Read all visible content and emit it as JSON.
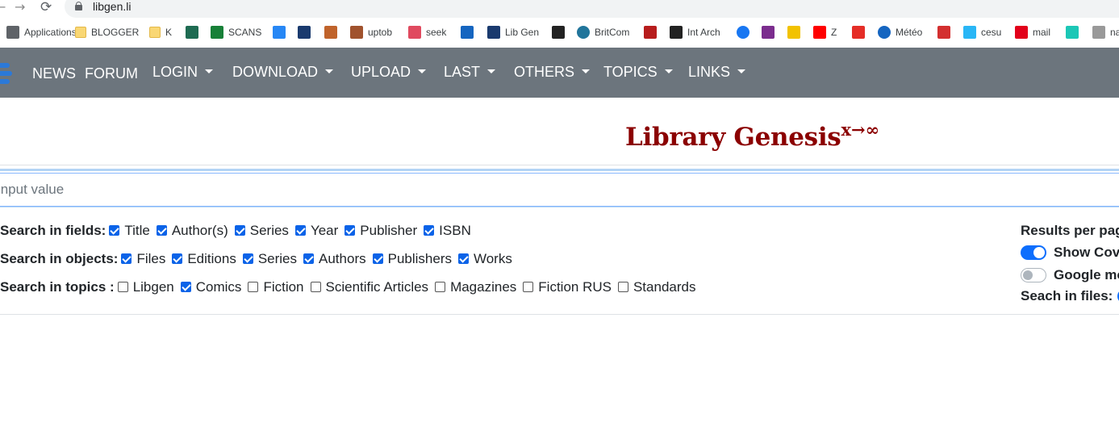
{
  "browser": {
    "back": "←",
    "forward": "→",
    "reload": "⟳",
    "url": "libgen.li",
    "bookmarks": [
      {
        "label": "Applications",
        "icon": "apps-grid-icon",
        "color": "#5f6368"
      },
      {
        "label": "BLOGGER",
        "icon": "folder-icon",
        "color": "#f9d774"
      },
      {
        "label": "K",
        "icon": "folder-icon",
        "color": "#f9d774"
      },
      {
        "label": "",
        "icon": "bookmark-icon",
        "color": "#1e6b52"
      },
      {
        "label": "SCANS",
        "icon": "plus-icon",
        "color": "#188038"
      },
      {
        "label": "",
        "icon": "vk-icon",
        "color": "#2787f5"
      },
      {
        "label": "",
        "icon": "site-icon",
        "color": "#1a3a6e"
      },
      {
        "label": "",
        "icon": "site-icon",
        "color": "#c0632b"
      },
      {
        "label": "uptob",
        "icon": "site-icon",
        "color": "#a0522d"
      },
      {
        "label": "seek",
        "icon": "site-icon",
        "color": "#e04a5f"
      },
      {
        "label": "",
        "icon": "up-icon",
        "color": "#1565c0"
      },
      {
        "label": "Lib Gen",
        "icon": "libgen-icon",
        "color": "#1a3a6e"
      },
      {
        "label": "",
        "icon": "site-icon",
        "color": "#222222"
      },
      {
        "label": "BritCom",
        "icon": "wordpress-icon",
        "color": "#21759b"
      },
      {
        "label": "",
        "icon": "site-icon",
        "color": "#b71c1c"
      },
      {
        "label": "Int Arch",
        "icon": "archive-icon",
        "color": "#222222"
      },
      {
        "label": "",
        "icon": "facebook-icon",
        "color": "#1877f2"
      },
      {
        "label": "",
        "icon": "site-icon",
        "color": "#7b2d8e"
      },
      {
        "label": "",
        "icon": "cb-icon",
        "color": "#f2c200"
      },
      {
        "label": "Z",
        "icon": "youtube-icon",
        "color": "#ff0000"
      },
      {
        "label": "",
        "icon": "play-icon",
        "color": "#e52d27"
      },
      {
        "label": "Météo",
        "icon": "weather-icon",
        "color": "#1565c0"
      },
      {
        "label": "",
        "icon": "site-icon",
        "color": "#d32f2f"
      },
      {
        "label": "cesu",
        "icon": "site-icon",
        "color": "#29b6f6"
      },
      {
        "label": "mail",
        "icon": "sfr-icon",
        "color": "#e2001a"
      },
      {
        "label": "",
        "icon": "v-icon",
        "color": "#1cc7b6"
      },
      {
        "label": "na",
        "icon": "site-icon",
        "color": "#999999"
      }
    ]
  },
  "navbar": {
    "items": [
      {
        "label": "NEWS",
        "dropdown": false
      },
      {
        "label": "FORUM",
        "dropdown": false
      },
      {
        "label": "LOGIN",
        "dropdown": true
      },
      {
        "label": "DOWNLOAD",
        "dropdown": true
      },
      {
        "label": "UPLOAD",
        "dropdown": true
      },
      {
        "label": "LAST",
        "dropdown": true
      },
      {
        "label": "OTHERS",
        "dropdown": true
      },
      {
        "label": "TOPICS",
        "dropdown": true
      },
      {
        "label": "LINKS",
        "dropdown": true
      }
    ]
  },
  "title": {
    "main": "Library Genesis",
    "sup": "x→∞"
  },
  "search": {
    "placeholder": "Input value",
    "value": ""
  },
  "fields": {
    "label": "Search in fields:",
    "options": [
      {
        "label": "Title",
        "checked": true
      },
      {
        "label": "Author(s)",
        "checked": true
      },
      {
        "label": "Series",
        "checked": true
      },
      {
        "label": "Year",
        "checked": true
      },
      {
        "label": "Publisher",
        "checked": true
      },
      {
        "label": "ISBN",
        "checked": true
      }
    ]
  },
  "objects": {
    "label": "Search in objects:",
    "options": [
      {
        "label": "Files",
        "checked": true
      },
      {
        "label": "Editions",
        "checked": true
      },
      {
        "label": "Series",
        "checked": true
      },
      {
        "label": "Authors",
        "checked": true
      },
      {
        "label": "Publishers",
        "checked": true
      },
      {
        "label": "Works",
        "checked": true
      }
    ]
  },
  "topics": {
    "label": "Search in topics :",
    "options": [
      {
        "label": "Libgen",
        "checked": false
      },
      {
        "label": "Comics",
        "checked": true
      },
      {
        "label": "Fiction",
        "checked": false
      },
      {
        "label": "Scientific Articles",
        "checked": false
      },
      {
        "label": "Magazines",
        "checked": false
      },
      {
        "label": "Fiction RUS",
        "checked": false
      },
      {
        "label": "Standards",
        "checked": false
      }
    ]
  },
  "right_panel": {
    "results_per_page": "Results per pag",
    "show_covers": {
      "label": "Show Cov",
      "on": true
    },
    "google_mode": {
      "label": "Google mo",
      "on": false
    },
    "search_in_files": "Seach in files:"
  }
}
